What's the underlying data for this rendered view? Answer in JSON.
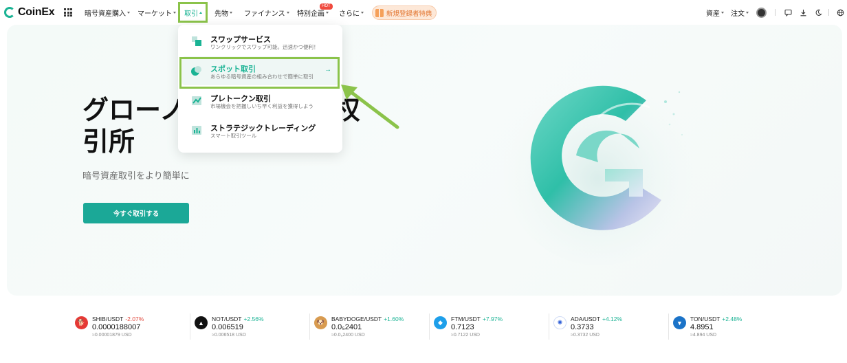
{
  "brand": {
    "name": "CoinEx",
    "accent": "#1ab394",
    "highlight": "#8bc34a"
  },
  "nav": {
    "items": [
      {
        "label": "暗号資産購入"
      },
      {
        "label": "マーケット"
      },
      {
        "label": "取引"
      },
      {
        "label": "先物"
      },
      {
        "label": "ファイナンス"
      },
      {
        "label": "特別企画"
      },
      {
        "label": "さらに"
      }
    ],
    "hot_badge": "HOT",
    "promo_label": "新規登録者特典",
    "right": {
      "assets": "資産",
      "orders": "注文"
    }
  },
  "hero": {
    "title": "グローバル暗号資産取引所",
    "title_line1": "グローノ",
    "title_line1_tail": "权",
    "title_line2": "引所",
    "subtitle": "暗号資産取引をより簡単に",
    "cta_label": "今すぐ取引する"
  },
  "dropdown": {
    "items": [
      {
        "title": "スワップサービス",
        "desc": "ワンクリックでスワップ可能。迅速かつ便利！"
      },
      {
        "title": "スポット取引",
        "desc": "あらゆる暗号資産の組み合わせで簡単に取引"
      },
      {
        "title": "プレトークン取引",
        "desc": "市場機会を把握しいち早く利益を獲得しよう"
      },
      {
        "title": "ストラテジックトレーディング",
        "desc": "スマート取引ツール"
      }
    ]
  },
  "tickers": [
    {
      "pair": "SHIB/USDT",
      "change": "-2.07%",
      "price": "0.0000188007",
      "usd": "≈0.00001879 USD",
      "icon": "shib-icon",
      "color": "#e53935"
    },
    {
      "pair": "NOT/USDT",
      "change": "+2.56%",
      "price": "0.006519",
      "usd": "≈0.006518 USD",
      "icon": "not-icon",
      "color": "#111111"
    },
    {
      "pair": "BABYDOGE/USDT",
      "change": "+1.60%",
      "price": "0.0₅2401",
      "usd": "≈0.0₅2400 USD",
      "icon": "babydoge-icon",
      "color": "#d89b50"
    },
    {
      "pair": "FTM/USDT",
      "change": "+7.97%",
      "price": "0.7123",
      "usd": "≈0.7122 USD",
      "icon": "ftm-icon",
      "color": "#1e9fea"
    },
    {
      "pair": "ADA/USDT",
      "change": "+4.12%",
      "price": "0.3733",
      "usd": "≈0.3732 USD",
      "icon": "ada-icon",
      "color": "#2a5bd7"
    },
    {
      "pair": "TON/USDT",
      "change": "+2.48%",
      "price": "4.8951",
      "usd": "≈4.894 USD",
      "icon": "ton-icon",
      "color": "#1b73c8"
    }
  ]
}
